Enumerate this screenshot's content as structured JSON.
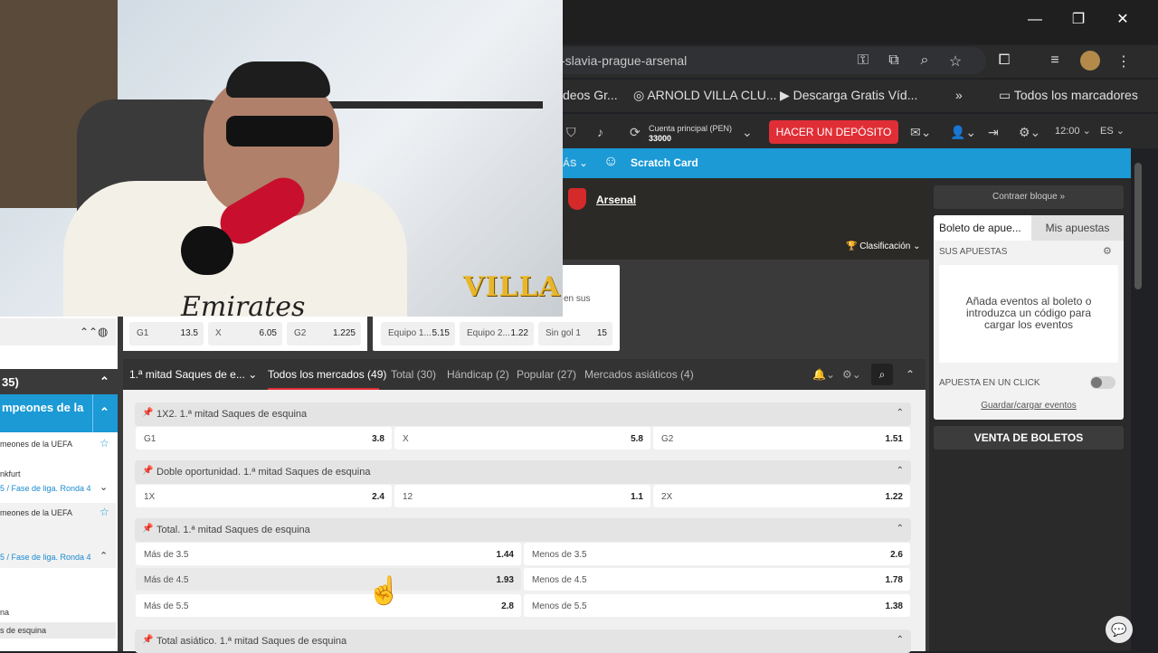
{
  "window": {
    "minimize": "—",
    "restore": "❐",
    "close": "✕"
  },
  "browser": {
    "url": "-slavia-prague-arsenal",
    "bookmarks": [
      {
        "label": "deos Gr..."
      },
      {
        "label": "ARNOLD VILLA CLU..."
      },
      {
        "label": "Descarga Gratis Víd..."
      },
      {
        "label": "»"
      },
      {
        "label": "Todos los marcadores"
      }
    ]
  },
  "header": {
    "account_label": "Cuenta principal  (PEN)",
    "account_value": "33000",
    "deposit_button": "HACER UN DEPÓSITO",
    "time": "12:00",
    "lang": "ES"
  },
  "nav": {
    "more": "ÁS",
    "scratch": "Scratch Card"
  },
  "match": {
    "team": "Arsenal",
    "classification": "Clasificación"
  },
  "quick_odds": [
    {
      "label": "G1",
      "value": "13.5"
    },
    {
      "label": "X",
      "value": "6.05"
    },
    {
      "label": "G2",
      "value": "1.225"
    },
    {
      "label": "Equipo 1...",
      "value": "5.15"
    },
    {
      "label": "Equipo 2...",
      "value": "1.22"
    },
    {
      "label": "Sin gol 1",
      "value": "15"
    }
  ],
  "card_snippet": "en sus",
  "tabs": {
    "first": "1.ª mitad Saques de e...",
    "items": [
      {
        "label": "Todos los mercados (49)"
      },
      {
        "label": "Total (30)"
      },
      {
        "label": "Hándicap (2)"
      },
      {
        "label": "Popular (27)"
      },
      {
        "label": "Mercados asiáticos (4)"
      }
    ]
  },
  "markets": [
    {
      "title": "1X2. 1.ª mitad Saques de esquina",
      "odds": [
        {
          "label": "G1",
          "value": "3.8"
        },
        {
          "label": "X",
          "value": "5.8"
        },
        {
          "label": "G2",
          "value": "1.51"
        }
      ]
    },
    {
      "title": "Doble oportunidad. 1.ª mitad Saques de esquina",
      "odds": [
        {
          "label": "1X",
          "value": "2.4"
        },
        {
          "label": "12",
          "value": "1.1"
        },
        {
          "label": "2X",
          "value": "1.22"
        }
      ]
    },
    {
      "title": "Total. 1.ª mitad Saques de esquina",
      "odds": [
        {
          "label": "Más de 3.5",
          "value": "1.44"
        },
        {
          "label": "Menos de 3.5",
          "value": "2.6"
        },
        {
          "label": "Más de 4.5",
          "value": "1.93"
        },
        {
          "label": "Menos de 4.5",
          "value": "1.78"
        },
        {
          "label": "Más de 5.5",
          "value": "2.8"
        },
        {
          "label": "Menos de 5.5",
          "value": "1.38"
        }
      ]
    },
    {
      "title": "Total asiático. 1.ª mitad Saques de esquina"
    }
  ],
  "betslip": {
    "collapse": "Contraer bloque »",
    "tab_active": "Boleto de apue...",
    "tab_other": "Mis apuestas",
    "section": "SUS APUESTAS",
    "empty": "Añada eventos al boleto o introduzca un código para cargar los eventos",
    "one_click": "APUESTA EN UN CLICK",
    "save": "Guardar/cargar eventos",
    "sale": "VENTA DE BOLETOS"
  },
  "left_panel": {
    "section": "35)",
    "blue_title": "mpeones de la",
    "lines": [
      "meones de la UEFA",
      "nkfurt",
      "5 / Fase de liga. Ronda 4",
      "meones de la UEFA",
      "5 / Fase de liga. Ronda 4",
      "na",
      "s de esquina"
    ]
  },
  "webcam": {
    "logo": "VILLA",
    "shirt_text": "Emirates"
  },
  "colors": {
    "accent_red": "#e02e36",
    "brand_blue": "#1b9ad6"
  }
}
